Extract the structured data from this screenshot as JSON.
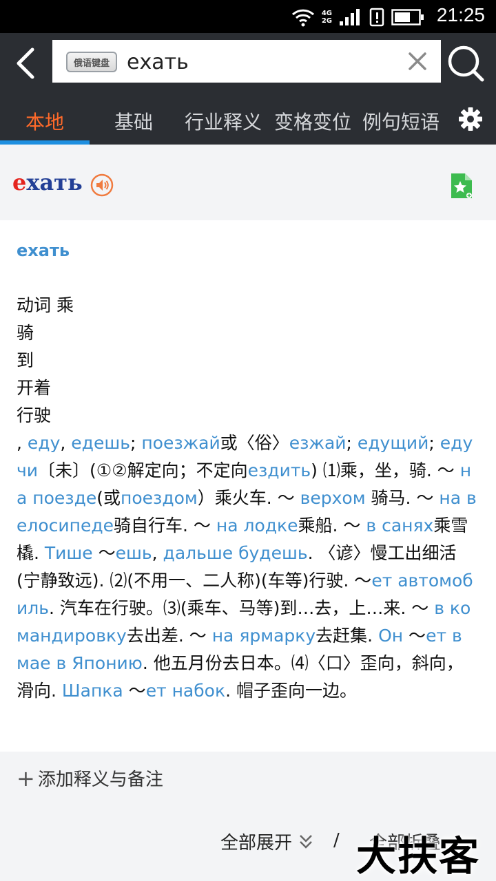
{
  "status_bar": {
    "time": "21:25",
    "network_top": "4G",
    "network_bottom": "2G",
    "icons": [
      "wifi-icon",
      "signal-icon",
      "alert-icon",
      "battery-icon"
    ]
  },
  "toolbar": {
    "keyboard_label": "俄语键盘",
    "search_value": "ехать",
    "icons": [
      "back-icon",
      "clear-icon",
      "search-icon"
    ]
  },
  "tabs": [
    {
      "label": "本地",
      "active": true
    },
    {
      "label": "基础",
      "active": false
    },
    {
      "label": "行业释义",
      "active": false
    },
    {
      "label": "变格变位",
      "active": false
    },
    {
      "label": "例句短语",
      "active": false
    }
  ],
  "headword": {
    "first_letter": "е",
    "rest": "хать"
  },
  "entry": {
    "title": "ехать",
    "senses": [
      "动词 乘",
      "骑",
      "到",
      "开着",
      "行驶"
    ],
    "definition": [
      {
        "t": ", ",
        "ru": false
      },
      {
        "t": "еду",
        "ru": true
      },
      {
        "t": ", ",
        "ru": false
      },
      {
        "t": "едешь",
        "ru": true
      },
      {
        "t": "; ",
        "ru": false
      },
      {
        "t": "поезжай",
        "ru": true
      },
      {
        "t": "或〈俗〉",
        "ru": false
      },
      {
        "t": "езжай",
        "ru": true
      },
      {
        "t": "; ",
        "ru": false
      },
      {
        "t": "едущий",
        "ru": true
      },
      {
        "t": "; ",
        "ru": false
      },
      {
        "t": "едучи",
        "ru": true
      },
      {
        "t": "〔未〕(①②解定向；不定向",
        "ru": false
      },
      {
        "t": "ездить",
        "ru": true
      },
      {
        "t": ") ⑴乘，坐，骑. ～ ",
        "ru": false
      },
      {
        "t": "на поезде",
        "ru": true
      },
      {
        "t": "(或",
        "ru": false
      },
      {
        "t": "поездом",
        "ru": true
      },
      {
        "t": "）乘火车. ～ ",
        "ru": false
      },
      {
        "t": "верхом",
        "ru": true
      },
      {
        "t": " 骑马. ～ ",
        "ru": false
      },
      {
        "t": "на велосипеде",
        "ru": true
      },
      {
        "t": "骑自行车. ～ ",
        "ru": false
      },
      {
        "t": "на лодке",
        "ru": true
      },
      {
        "t": "乘船. ～ ",
        "ru": false
      },
      {
        "t": "в санях",
        "ru": true
      },
      {
        "t": "乘雪橇. ",
        "ru": false
      },
      {
        "t": "Тише",
        "ru": true
      },
      {
        "t": " ～",
        "ru": false
      },
      {
        "t": "ешь",
        "ru": true
      },
      {
        "t": ", ",
        "ru": false
      },
      {
        "t": "дальше будешь",
        "ru": true
      },
      {
        "t": ". 〈谚〉慢工出细活(宁静致远). ⑵(不用一、二人称)(车等)行驶. ～",
        "ru": false
      },
      {
        "t": "ет автомобиль",
        "ru": true
      },
      {
        "t": ". 汽车在行驶。⑶(乘车、马等)到…去，上…来. ～ ",
        "ru": false
      },
      {
        "t": "в командировку",
        "ru": true
      },
      {
        "t": "去出差. ～ ",
        "ru": false
      },
      {
        "t": "на ярмарку",
        "ru": true
      },
      {
        "t": "去赶集. ",
        "ru": false
      },
      {
        "t": "Он",
        "ru": true
      },
      {
        "t": " ～",
        "ru": false
      },
      {
        "t": "ет в мае в Японию",
        "ru": true
      },
      {
        "t": ". 他五月份去日本。⑷〈口〉歪向，斜向，滑向. ",
        "ru": false
      },
      {
        "t": "Шапка",
        "ru": true
      },
      {
        "t": " ～",
        "ru": false
      },
      {
        "t": "ет набок",
        "ru": true
      },
      {
        "t": ". 帽子歪向一边。",
        "ru": false
      }
    ]
  },
  "footer": {
    "add_note": "添加释义与备注",
    "expand_all": "全部展开",
    "separator": "/",
    "collapse_all": "全部折叠",
    "watermark": "大扶客"
  },
  "colors": {
    "accent_tab": "#ff6a2a",
    "tab_underline": "#1e8fe0",
    "russian_link": "#3f8fcf",
    "headword_first": "#e5251f",
    "headword_rest": "#233f96",
    "speaker": "#f07b3f",
    "favorite": "#3dbb4f",
    "top_bar": "#2b2e33"
  }
}
